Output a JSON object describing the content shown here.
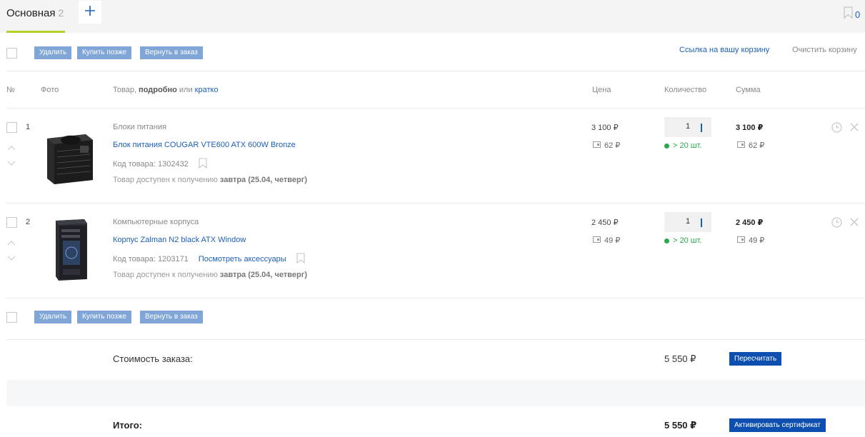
{
  "tabs": {
    "main_label": "Основная",
    "main_count": "2",
    "add_icon": "plus-icon",
    "favorites_count": "0"
  },
  "bulk_actions": {
    "delete": "Удалить",
    "buy_later": "Купить позже",
    "return_to_order": "Вернуть в заказ"
  },
  "top_links": {
    "cart_link": "Ссылка на вашу корзину",
    "clear_cart": "Очистить корзину"
  },
  "columns": {
    "num": "№",
    "photo": "Фото",
    "product_prefix": "Товар, ",
    "product_detailed": "подробно",
    "product_or": " или ",
    "product_brief": "кратко",
    "price": "Цена",
    "quantity": "Количество",
    "sum": "Сумма"
  },
  "items": [
    {
      "num": "1",
      "category": "Блоки питания",
      "name": "Блок питания COUGAR VTE600 ATX 600W Bronze",
      "code": "Код товара: 1302432",
      "availability_prefix": "Товар доступен к получению ",
      "availability_date": "завтра (25.04, четверг)",
      "price": "3 100 ₽",
      "price_bonus": "62 ₽",
      "quantity": "1",
      "stock": "> 20 шт.",
      "sum": "3 100 ₽",
      "sum_bonus": "62 ₽"
    },
    {
      "num": "2",
      "category": "Компьютерные корпуса",
      "name": "Корпус Zalman N2 black ATX Window",
      "code": "Код товара: 1203171",
      "accessories_link": "Посмотреть аксессуары",
      "availability_prefix": "Товар доступен к получению ",
      "availability_date": "завтра (25.04, четверг)",
      "price": "2 450 ₽",
      "price_bonus": "49 ₽",
      "quantity": "1",
      "stock": "> 20 шт.",
      "sum": "2 450 ₽",
      "sum_bonus": "49 ₽"
    }
  ],
  "summary": {
    "order_cost_label": "Стоимость заказа:",
    "order_cost_value": "5 550 ₽",
    "recalculate": "Пересчитать",
    "total_label": "Итого:",
    "total_value": "5 550 ₽",
    "activate_certificate": "Активировать сертификат"
  },
  "colors": {
    "accent": "#1b5fb8",
    "tab_underline": "#b5d22b",
    "stock_green": "#2aa84a",
    "bulk_button": "#7fa6d6",
    "primary_button": "#0d4fb0"
  }
}
